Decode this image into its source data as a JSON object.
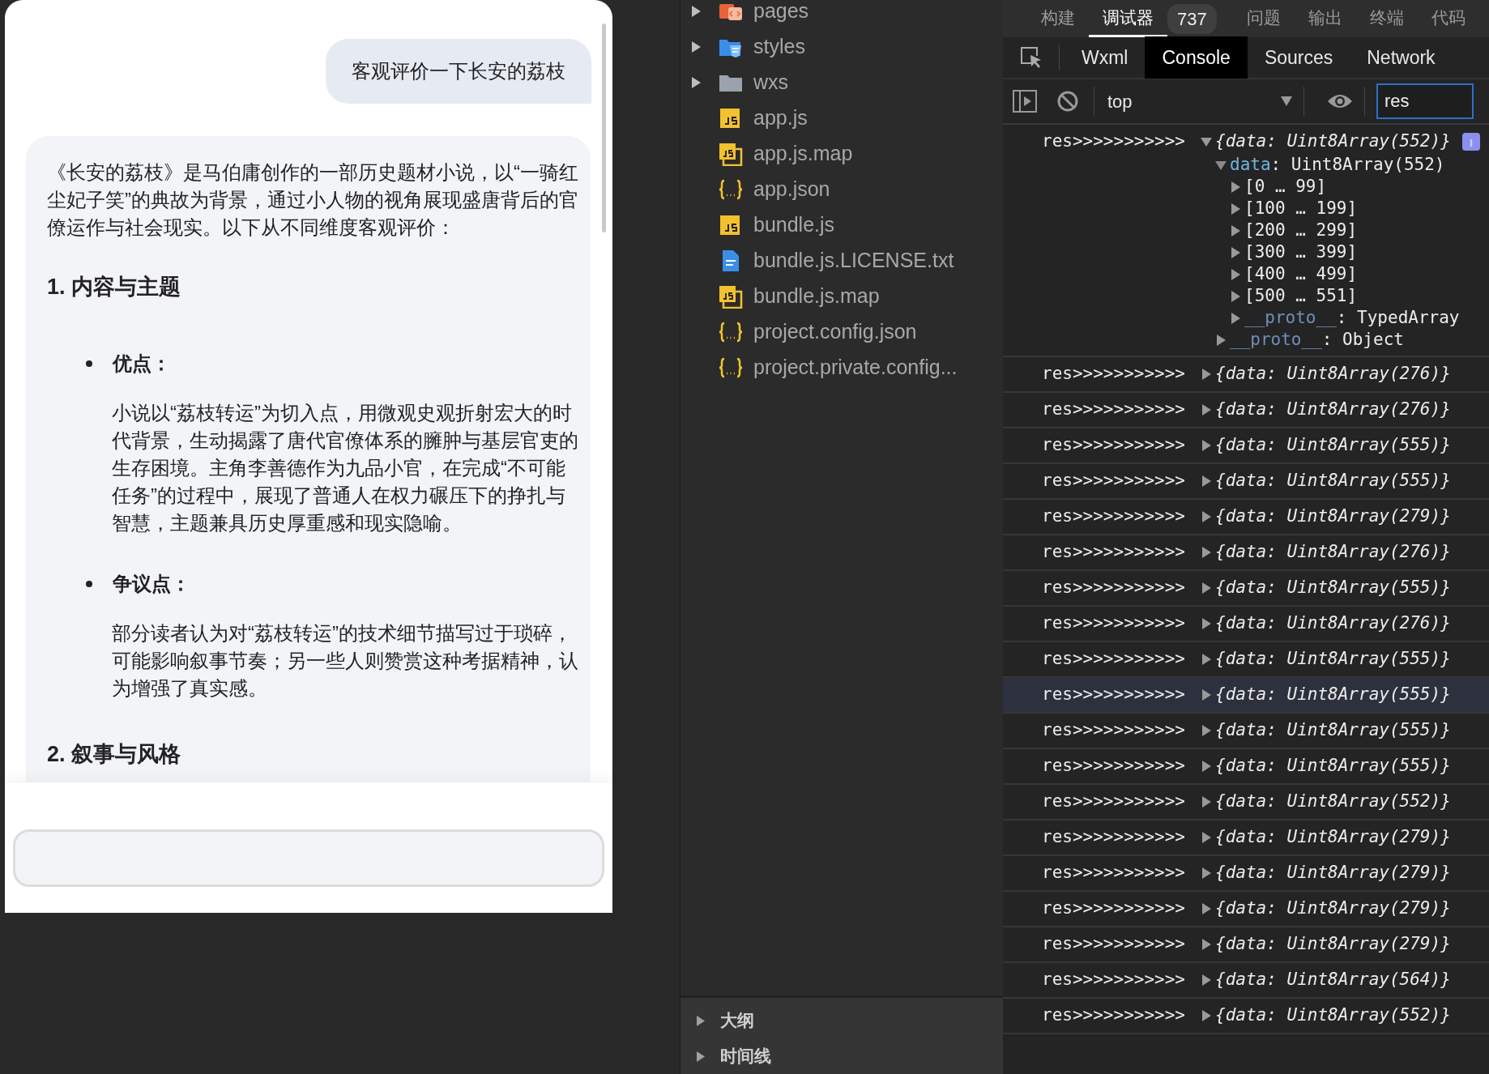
{
  "simulator": {
    "user_message": "客观评价一下长安的荔枝",
    "reply": {
      "intro": "《长安的荔枝》是马伯庸创作的一部历史题材小说，以“一骑红尘妃子笑”的典故为背景，通过小人物的视角展现盛唐背后的官僚运作与社会现实。以下从不同维度客观评价：",
      "sections": [
        {
          "heading": "1. 内容与主题",
          "points": [
            {
              "label": "优点：",
              "text": "小说以“荔枝转运”为切入点，用微观史观折射宏大的时代背景，生动揭露了唐代官僚体系的臃肿与基层官吏的生存困境。主角李善德作为九品小官，在完成“不可能任务”的过程中，展现了普通人在权力碾压下的挣扎与智慧，主题兼具历史厚重感和现实隐喻。"
            },
            {
              "label": "争议点：",
              "text": "部分读者认为对“荔枝转运”的技术细节描写过于琐碎，可能影响叙事节奏；另一些人则赞赏这种考据精神，认为增强了真实感。"
            }
          ]
        },
        {
          "heading": "2. 叙事与风格"
        }
      ]
    }
  },
  "file_tree": {
    "items": [
      {
        "name": "pages",
        "kind": "page-folder",
        "expanded": false
      },
      {
        "name": "styles",
        "kind": "style-folder",
        "expanded": false
      },
      {
        "name": "wxs",
        "kind": "folder",
        "expanded": false
      },
      {
        "name": "app.js",
        "kind": "js"
      },
      {
        "name": "app.js.map",
        "kind": "map"
      },
      {
        "name": "app.json",
        "kind": "json"
      },
      {
        "name": "bundle.js",
        "kind": "js"
      },
      {
        "name": "bundle.js.LICENSE.txt",
        "kind": "text"
      },
      {
        "name": "bundle.js.map",
        "kind": "map"
      },
      {
        "name": "project.config.json",
        "kind": "json"
      },
      {
        "name": "project.private.config...",
        "kind": "json"
      }
    ]
  },
  "bottom_panels": [
    {
      "label": "大纲",
      "expanded": false
    },
    {
      "label": "时间线",
      "expanded": false
    }
  ],
  "devtools": {
    "top_tabs": [
      {
        "label": "构建",
        "selected": false
      },
      {
        "label": "调试器",
        "selected": true,
        "badge": "737"
      },
      {
        "label": "问题",
        "selected": false
      },
      {
        "label": "输出",
        "selected": false
      },
      {
        "label": "终端",
        "selected": false
      },
      {
        "label": "代码",
        "selected": false
      }
    ],
    "panel_tabs": [
      {
        "label": "Wxml",
        "selected": false
      },
      {
        "label": "Console",
        "selected": true
      },
      {
        "label": "Sources",
        "selected": false
      },
      {
        "label": "Network",
        "selected": false
      }
    ],
    "context": "top",
    "filter": "res",
    "entries": [
      {
        "prefix": "res>>>>>>>>>>>",
        "summary": "{data: Uint8Array(552)}",
        "expanded": true,
        "selected": false,
        "children": [
          {
            "key": "data",
            "kind": "property",
            "value": ": Uint8Array(552)",
            "expanded": true,
            "children": [
              {
                "key": "[0 … 99]",
                "kind": "range",
                "expanded": false
              },
              {
                "key": "[100 … 199]",
                "kind": "range",
                "expanded": false
              },
              {
                "key": "[200 … 299]",
                "kind": "range",
                "expanded": false
              },
              {
                "key": "[300 … 399]",
                "kind": "range",
                "expanded": false
              },
              {
                "key": "[400 … 499]",
                "kind": "range",
                "expanded": false
              },
              {
                "key": "[500 … 551]",
                "kind": "range",
                "expanded": false
              },
              {
                "key": "__proto__",
                "kind": "internal",
                "value": ": TypedArray",
                "expanded": false
              }
            ]
          },
          {
            "key": "__proto__",
            "kind": "internal",
            "value": ": Object",
            "expanded": false
          }
        ]
      },
      {
        "prefix": "res>>>>>>>>>>>",
        "summary": "{data: Uint8Array(276)}",
        "expanded": false,
        "selected": false
      },
      {
        "prefix": "res>>>>>>>>>>>",
        "summary": "{data: Uint8Array(276)}",
        "expanded": false,
        "selected": false
      },
      {
        "prefix": "res>>>>>>>>>>>",
        "summary": "{data: Uint8Array(555)}",
        "expanded": false,
        "selected": false
      },
      {
        "prefix": "res>>>>>>>>>>>",
        "summary": "{data: Uint8Array(555)}",
        "expanded": false,
        "selected": false
      },
      {
        "prefix": "res>>>>>>>>>>>",
        "summary": "{data: Uint8Array(279)}",
        "expanded": false,
        "selected": false
      },
      {
        "prefix": "res>>>>>>>>>>>",
        "summary": "{data: Uint8Array(276)}",
        "expanded": false,
        "selected": false
      },
      {
        "prefix": "res>>>>>>>>>>>",
        "summary": "{data: Uint8Array(555)}",
        "expanded": false,
        "selected": false
      },
      {
        "prefix": "res>>>>>>>>>>>",
        "summary": "{data: Uint8Array(276)}",
        "expanded": false,
        "selected": false
      },
      {
        "prefix": "res>>>>>>>>>>>",
        "summary": "{data: Uint8Array(555)}",
        "expanded": false,
        "selected": false
      },
      {
        "prefix": "res>>>>>>>>>>>",
        "summary": "{data: Uint8Array(555)}",
        "expanded": false,
        "selected": true
      },
      {
        "prefix": "res>>>>>>>>>>>",
        "summary": "{data: Uint8Array(555)}",
        "expanded": false,
        "selected": false
      },
      {
        "prefix": "res>>>>>>>>>>>",
        "summary": "{data: Uint8Array(555)}",
        "expanded": false,
        "selected": false
      },
      {
        "prefix": "res>>>>>>>>>>>",
        "summary": "{data: Uint8Array(552)}",
        "expanded": false,
        "selected": false
      },
      {
        "prefix": "res>>>>>>>>>>>",
        "summary": "{data: Uint8Array(279)}",
        "expanded": false,
        "selected": false
      },
      {
        "prefix": "res>>>>>>>>>>>",
        "summary": "{data: Uint8Array(279)}",
        "expanded": false,
        "selected": false
      },
      {
        "prefix": "res>>>>>>>>>>>",
        "summary": "{data: Uint8Array(279)}",
        "expanded": false,
        "selected": false
      },
      {
        "prefix": "res>>>>>>>>>>>",
        "summary": "{data: Uint8Array(279)}",
        "expanded": false,
        "selected": false
      },
      {
        "prefix": "res>>>>>>>>>>>",
        "summary": "{data: Uint8Array(564)}",
        "expanded": false,
        "selected": false
      },
      {
        "prefix": "res>>>>>>>>>>>",
        "summary": "{data: Uint8Array(552)}",
        "expanded": false,
        "selected": false
      }
    ]
  }
}
